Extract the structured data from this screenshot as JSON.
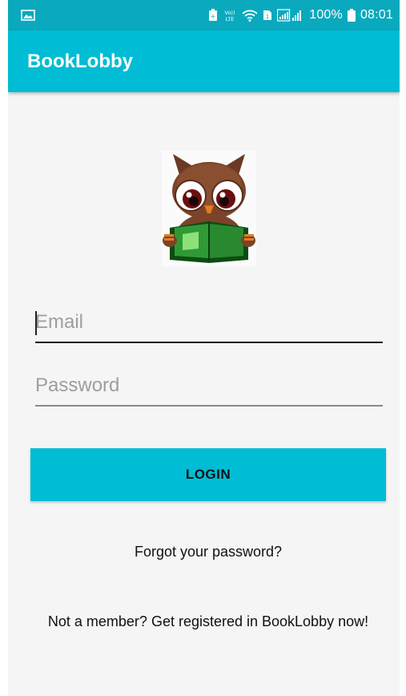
{
  "status_bar": {
    "battery_percent": "100%",
    "time": "08:01",
    "icons": [
      "image-icon",
      "battery-saver-icon",
      "volte-icon",
      "wifi-icon",
      "sim-icon",
      "signal-icon",
      "battery-icon"
    ]
  },
  "app_bar": {
    "title": "BookLobby"
  },
  "logo": {
    "icon": "owl-reading-book-icon"
  },
  "form": {
    "email_placeholder": "Email",
    "password_placeholder": "Password",
    "login_label": "LOGIN"
  },
  "links": {
    "forgot_password": "Forgot your password?",
    "register": "Not a member? Get registered in BookLobby now!"
  },
  "colors": {
    "primary": "#00bcd4",
    "primary_dark": "#0aa9be",
    "background": "#f5f5f5"
  }
}
